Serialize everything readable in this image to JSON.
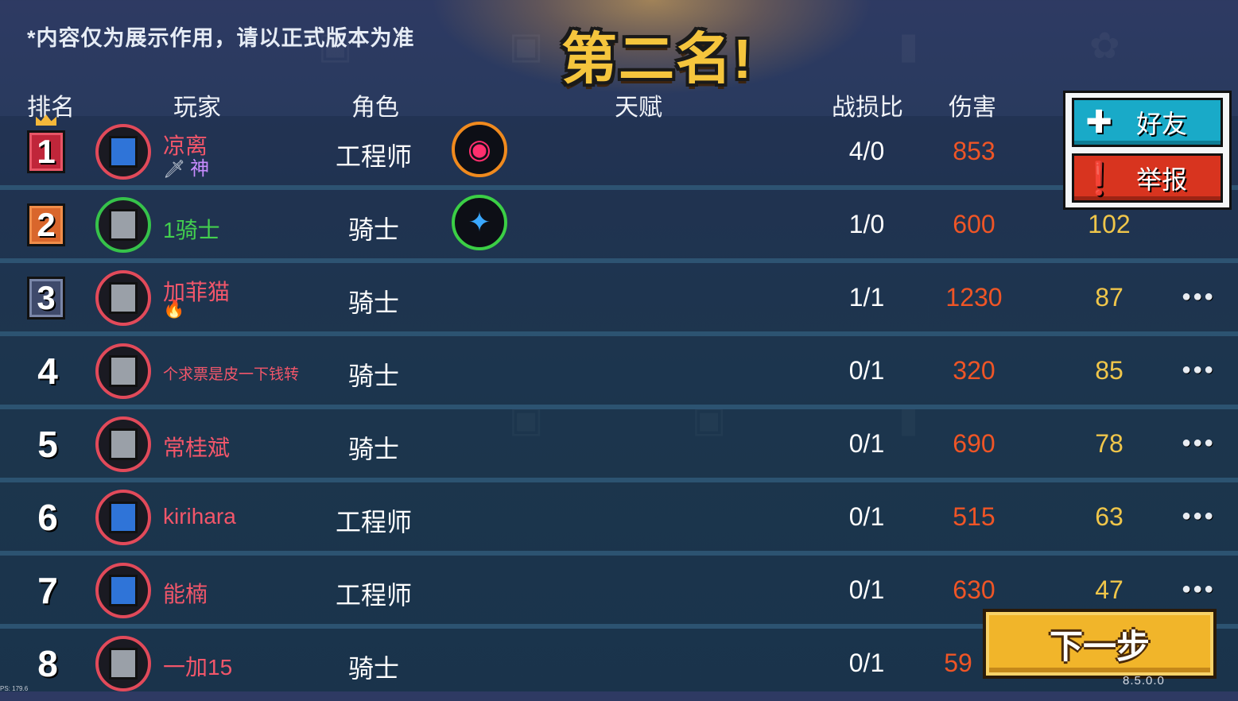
{
  "disclaimer": "*内容仅为展示作用，请以正式版本为准",
  "title": "第二名!",
  "headers": {
    "rank": "排名",
    "player": "玩家",
    "role": "角色",
    "talent": "天赋",
    "kd": "战损比",
    "damage": "伤害"
  },
  "rows": [
    {
      "rank": "1",
      "name": "凉离",
      "role": "工程师",
      "kd": "4/0",
      "damage": "853",
      "score": "",
      "tag": "神"
    },
    {
      "rank": "2",
      "name": "1骑士",
      "role": "骑士",
      "kd": "1/0",
      "damage": "600",
      "score": "102"
    },
    {
      "rank": "3",
      "name": "加菲猫",
      "role": "骑士",
      "kd": "1/1",
      "damage": "1230",
      "score": "87"
    },
    {
      "rank": "4",
      "name": "个求票是皮一下钱转",
      "role": "骑士",
      "kd": "0/1",
      "damage": "320",
      "score": "85"
    },
    {
      "rank": "5",
      "name": "常桂斌",
      "role": "骑士",
      "kd": "0/1",
      "damage": "690",
      "score": "78"
    },
    {
      "rank": "6",
      "name": "kirihara",
      "role": "工程师",
      "kd": "0/1",
      "damage": "515",
      "score": "63"
    },
    {
      "rank": "7",
      "name": "能楠",
      "role": "工程师",
      "kd": "0/1",
      "damage": "630",
      "score": "47"
    },
    {
      "rank": "8",
      "name": "一加15",
      "role": "骑士",
      "kd": "0/1",
      "damage": "59",
      "score": ""
    }
  ],
  "popup": {
    "friend_label": "好友",
    "report_label": "举报",
    "friend_icon": "plus-icon",
    "report_icon": "exclamation-icon"
  },
  "more_glyph": "●●●",
  "next_label": "下一步",
  "version": "8.5.0.0",
  "fps": "PS: 179.6",
  "colors": {
    "damage": "#ef5526",
    "score": "#f0c64a",
    "player_name": "#f2566a",
    "friend_name": "#43d04e",
    "title": "#f5c53d",
    "next_button": "#f1b52a",
    "friend_button": "#19aac8",
    "report_button": "#d8341f"
  }
}
